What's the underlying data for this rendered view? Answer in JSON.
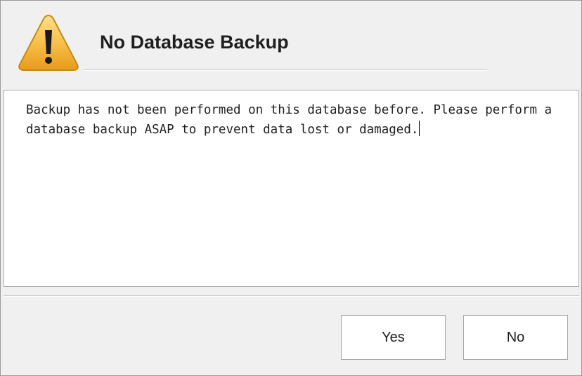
{
  "dialog": {
    "title": "No Database Backup",
    "icon": "warning-icon",
    "message": "Backup has not been performed on this database before. Please perform a\ndatabase backup ASAP to prevent data lost or damaged.",
    "buttons": {
      "yes_label": "Yes",
      "no_label": "No"
    }
  },
  "colors": {
    "warning_fill": "#f2b233",
    "warning_border": "#c58a12",
    "background": "#f0f0f0",
    "message_background": "#ffffff"
  }
}
